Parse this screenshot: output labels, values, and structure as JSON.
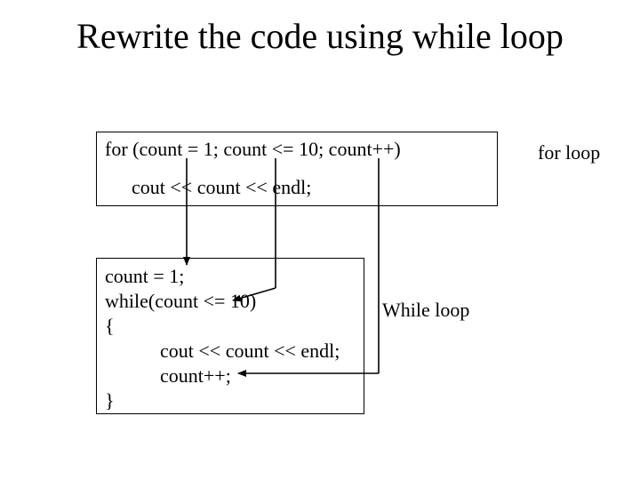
{
  "title": "Rewrite the code using while loop",
  "for_box": {
    "line1": "for (count = 1; count <= 10; count++)",
    "line2": "cout << count << endl;"
  },
  "while_box": {
    "line1": "count = 1;",
    "line2": "while(count <= 10)",
    "line3": "{",
    "line4": "cout << count << endl;",
    "line5": "count++;",
    "line6": "}"
  },
  "labels": {
    "for_loop": "for loop",
    "while_loop": "While loop"
  }
}
